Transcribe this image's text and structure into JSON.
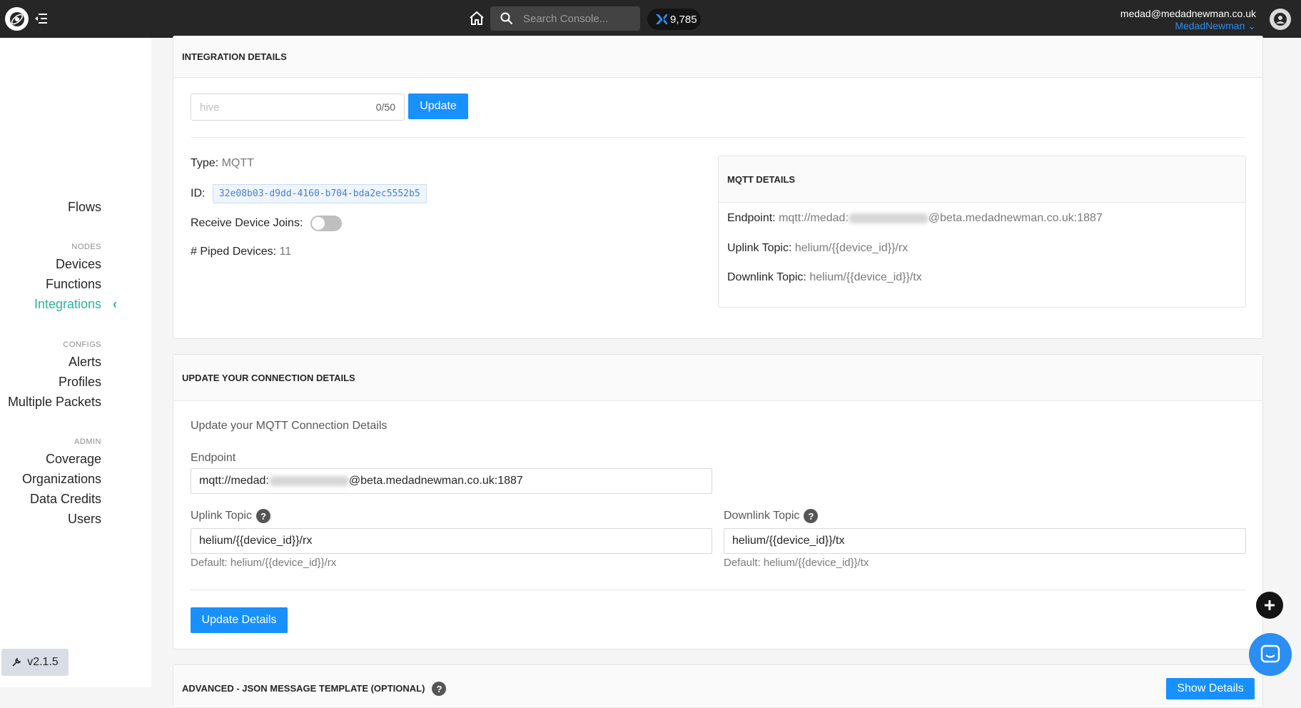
{
  "header": {
    "search_placeholder": "Search Console...",
    "data_credits": "9,785",
    "user_email": "medad@medadnewman.co.uk",
    "org_name": "MedadNewman"
  },
  "sidebar": {
    "flows": "Flows",
    "nodes_group": "NODES",
    "devices": "Devices",
    "functions": "Functions",
    "integrations": "Integrations",
    "configs_group": "CONFIGS",
    "alerts": "Alerts",
    "profiles": "Profiles",
    "multiple_packets": "Multiple Packets",
    "admin_group": "ADMIN",
    "coverage": "Coverage",
    "organizations": "Organizations",
    "data_credits": "Data Credits",
    "users": "Users",
    "version": "v2.1.5"
  },
  "integration_details": {
    "title": "INTEGRATION DETAILS",
    "name_placeholder": "hive",
    "char_count": "0/50",
    "update_label": "Update",
    "type_label": "Type:",
    "type_value": "MQTT",
    "id_label": "ID:",
    "id_value": "32e08b03-d9dd-4160-b704-bda2ec5552b5",
    "receive_joins_label": "Receive Device Joins:",
    "piped_label": "# Piped Devices:",
    "piped_value": "11"
  },
  "mqtt_details": {
    "title": "MQTT DETAILS",
    "endpoint_label": "Endpoint:",
    "endpoint_prefix": "mqtt://medad:",
    "endpoint_suffix": "@beta.medadnewman.co.uk:1887",
    "uplink_label": "Uplink Topic:",
    "uplink_value": "helium/{{device_id}}/rx",
    "downlink_label": "Downlink Topic:",
    "downlink_value": "helium/{{device_id}}/tx"
  },
  "connection": {
    "title": "UPDATE YOUR CONNECTION DETAILS",
    "subtitle": "Update your MQTT Connection Details",
    "endpoint_label": "Endpoint",
    "endpoint_prefix": "mqtt://medad:",
    "endpoint_suffix": "@beta.medadnewman.co.uk:1887",
    "uplink_label": "Uplink Topic",
    "uplink_value": "helium/{{device_id}}/rx",
    "uplink_default": "Default: helium/{{device_id}}/rx",
    "downlink_label": "Downlink Topic",
    "downlink_value": "helium/{{device_id}}/tx",
    "downlink_default": "Default: helium/{{device_id}}/tx",
    "update_details_label": "Update Details"
  },
  "advanced": {
    "title": "ADVANCED - JSON MESSAGE TEMPLATE (OPTIONAL)",
    "show_details_label": "Show Details"
  }
}
